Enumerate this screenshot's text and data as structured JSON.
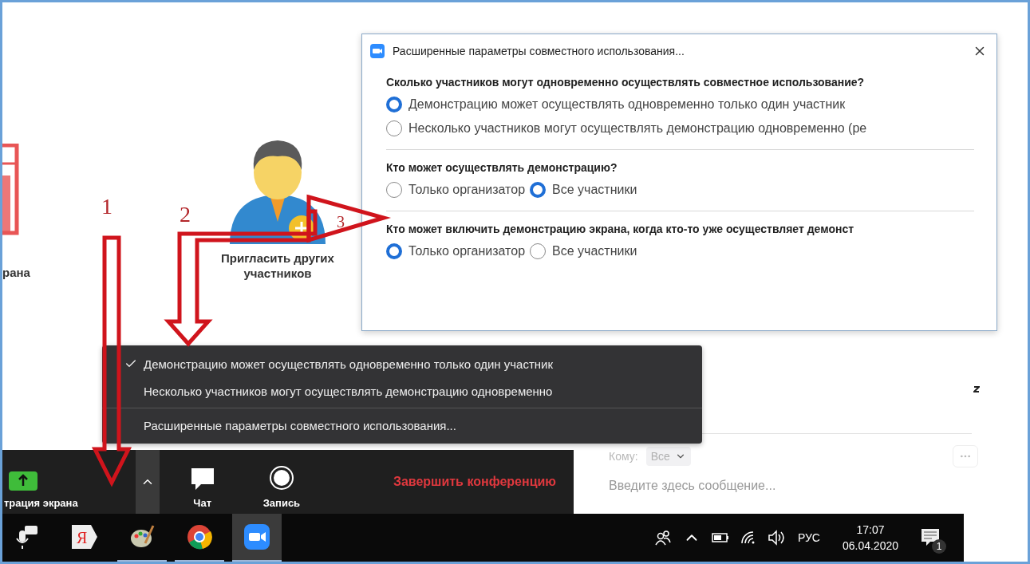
{
  "meeting": {
    "share_label": "рана",
    "invite_label": "Пригласить других участников"
  },
  "share_dialog": {
    "title": "Расширенные параметры совместного использования...",
    "sections": [
      {
        "question": "Сколько участников могут одновременно осуществлять совместное использование?",
        "kind": "stacked",
        "options": [
          {
            "label": "Демонстрацию может осуществлять одновременно только один участник",
            "selected": true
          },
          {
            "label": "Несколько участников могут осуществлять демонстрацию одновременно (ре",
            "selected": false
          }
        ]
      },
      {
        "question": "Кто может осуществлять демонстрацию?",
        "kind": "inline",
        "options": [
          {
            "label": "Только организатор",
            "selected": false
          },
          {
            "label": "Все участники",
            "selected": true
          }
        ]
      },
      {
        "question": "Кто может включить демонстрацию экрана, когда кто-то уже осуществляет демонст",
        "kind": "inline",
        "options": [
          {
            "label": "Только организатор",
            "selected": true
          },
          {
            "label": "Все участники",
            "selected": false
          }
        ]
      }
    ]
  },
  "share_menu": {
    "items": [
      {
        "kind": "check",
        "label": "Демонстрацию может осуществлять одновременно только один участник",
        "checked": true
      },
      {
        "kind": "check",
        "label": "Несколько участников могут осуществлять демонстрацию одновременно",
        "checked": false
      },
      {
        "kind": "separator"
      },
      {
        "kind": "action",
        "label": "Расширенные параметры совместного использования..."
      }
    ]
  },
  "toolbar": {
    "buttons": [
      {
        "kind": "share",
        "label": "трация экрана"
      },
      {
        "kind": "caret"
      },
      {
        "kind": "chat",
        "label": "Чат"
      },
      {
        "kind": "record",
        "label": "Запись"
      }
    ],
    "end_button": "Завершить конференцию"
  },
  "chat": {
    "to_label": "Кому:",
    "to_value": "Все",
    "placeholder": "Введите здесь сообщение..."
  },
  "taskbar": {
    "apps": [
      {
        "kind": "mic",
        "selected": false,
        "running": false
      },
      {
        "kind": "yandex",
        "label": "Я",
        "selected": false,
        "running": false
      },
      {
        "kind": "paint",
        "selected": false,
        "running": true
      },
      {
        "kind": "chrome",
        "selected": false,
        "running": true
      },
      {
        "kind": "zoom",
        "selected": true,
        "running": true
      }
    ],
    "language": "РУС",
    "time": "17:07",
    "date": "06.04.2020",
    "notifications": "1"
  },
  "annotations": [
    {
      "label": "1"
    },
    {
      "label": "2"
    },
    {
      "label": "3"
    }
  ]
}
